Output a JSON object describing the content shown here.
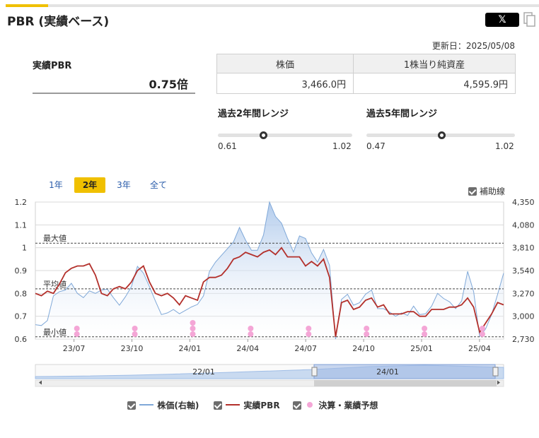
{
  "header": {
    "title": "PBR (実績ベース)",
    "share_label": "𝕏",
    "updated": "更新日：2025/05/08"
  },
  "pbr": {
    "label": "実績PBR",
    "value": "0.75倍"
  },
  "price_table": {
    "headers": [
      "株価",
      "1株当り純資産"
    ],
    "values": [
      "3,466.0円",
      "4,595.9円"
    ]
  },
  "ranges": [
    {
      "label": "過去2年間レンジ",
      "min": "0.61",
      "max": "1.02",
      "current": 0.75,
      "min_val": 0.61,
      "max_val": 1.02
    },
    {
      "label": "過去5年間レンジ",
      "min": "0.47",
      "max": "1.02",
      "current": 0.75,
      "min_val": 0.47,
      "max_val": 1.02
    }
  ],
  "periods": [
    "1年",
    "2年",
    "3年",
    "全て"
  ],
  "active_period": "2年",
  "aux_label": "補助線",
  "legend": [
    "株価(右軸)",
    "実績PBR",
    "決算・業績予想"
  ],
  "colors": {
    "pbr_line": "#b3302b",
    "price_line": "#7fa8d8",
    "price_fill_top": "#aac6ea",
    "event_dot": "#f4a6d6",
    "accent": "#f0c000"
  },
  "chart_data": {
    "type": "line",
    "x_start": "2023-05",
    "x_end": "2025-05",
    "x_ticks": [
      "23/07",
      "23/10",
      "24/01",
      "24/04",
      "24/07",
      "24/10",
      "25/01",
      "25/04"
    ],
    "y_left": {
      "min": 0.6,
      "max": 1.2,
      "ticks": [
        "0.6",
        "0.7",
        "0.8",
        "0.9",
        "1",
        "1.1",
        "1.2"
      ]
    },
    "y_right": {
      "min": 2730,
      "max": 4350,
      "ticks": [
        "2,730",
        "3,000",
        "3,270",
        "3,540",
        "3,810",
        "4,080",
        "4,350"
      ]
    },
    "reference_lines": [
      {
        "label": "最大値",
        "value": 1.02
      },
      {
        "label": "平均値",
        "value": 0.82
      },
      {
        "label": "最小値",
        "value": 0.61
      }
    ],
    "series": [
      {
        "name": "実績PBR",
        "axis": "left",
        "values": [
          0.8,
          0.79,
          0.81,
          0.8,
          0.84,
          0.89,
          0.91,
          0.92,
          0.92,
          0.93,
          0.88,
          0.8,
          0.79,
          0.82,
          0.83,
          0.82,
          0.85,
          0.9,
          0.92,
          0.85,
          0.8,
          0.79,
          0.8,
          0.78,
          0.75,
          0.79,
          0.78,
          0.77,
          0.85,
          0.87,
          0.87,
          0.88,
          0.91,
          0.95,
          0.96,
          0.98,
          0.97,
          0.96,
          0.98,
          0.99,
          0.97,
          1.0,
          0.96,
          0.96,
          0.96,
          0.92,
          0.94,
          0.92,
          0.95,
          0.87,
          0.61,
          0.76,
          0.77,
          0.73,
          0.74,
          0.77,
          0.78,
          0.74,
          0.75,
          0.71,
          0.71,
          0.71,
          0.72,
          0.72,
          0.7,
          0.7,
          0.73,
          0.73,
          0.73,
          0.74,
          0.74,
          0.75,
          0.78,
          0.74,
          0.63,
          0.67,
          0.71,
          0.76,
          0.75
        ]
      },
      {
        "name": "株価(右軸)",
        "axis": "right",
        "values": [
          2900,
          2890,
          2950,
          3240,
          3290,
          3310,
          3390,
          3270,
          3220,
          3300,
          3270,
          3310,
          3320,
          3220,
          3130,
          3230,
          3350,
          3590,
          3510,
          3350,
          3180,
          3020,
          3040,
          3080,
          3030,
          3070,
          3110,
          3140,
          3240,
          3530,
          3640,
          3720,
          3800,
          3880,
          4050,
          3900,
          3780,
          3780,
          3960,
          4350,
          4180,
          4100,
          3920,
          3760,
          3950,
          3920,
          3750,
          3640,
          3790,
          3600,
          2730,
          3200,
          3260,
          3130,
          3160,
          3260,
          3310,
          3090,
          3090,
          3050,
          3000,
          3040,
          3010,
          3120,
          3020,
          3030,
          3120,
          3270,
          3210,
          3170,
          3090,
          3180,
          3530,
          3290,
          2760,
          2850,
          3020,
          3260,
          3510
        ]
      }
    ],
    "events": [
      {
        "x": "2023-07"
      },
      {
        "x": "2023-10"
      },
      {
        "x": "2024-01"
      },
      {
        "x": "2024-04"
      },
      {
        "x": "2024-07"
      },
      {
        "x": "2024-10"
      },
      {
        "x": "2025-01"
      },
      {
        "x": "2025-04"
      }
    ],
    "navigator_labels": [
      "22/01",
      "24/01"
    ],
    "grid": true,
    "legend_position": "bottom"
  }
}
